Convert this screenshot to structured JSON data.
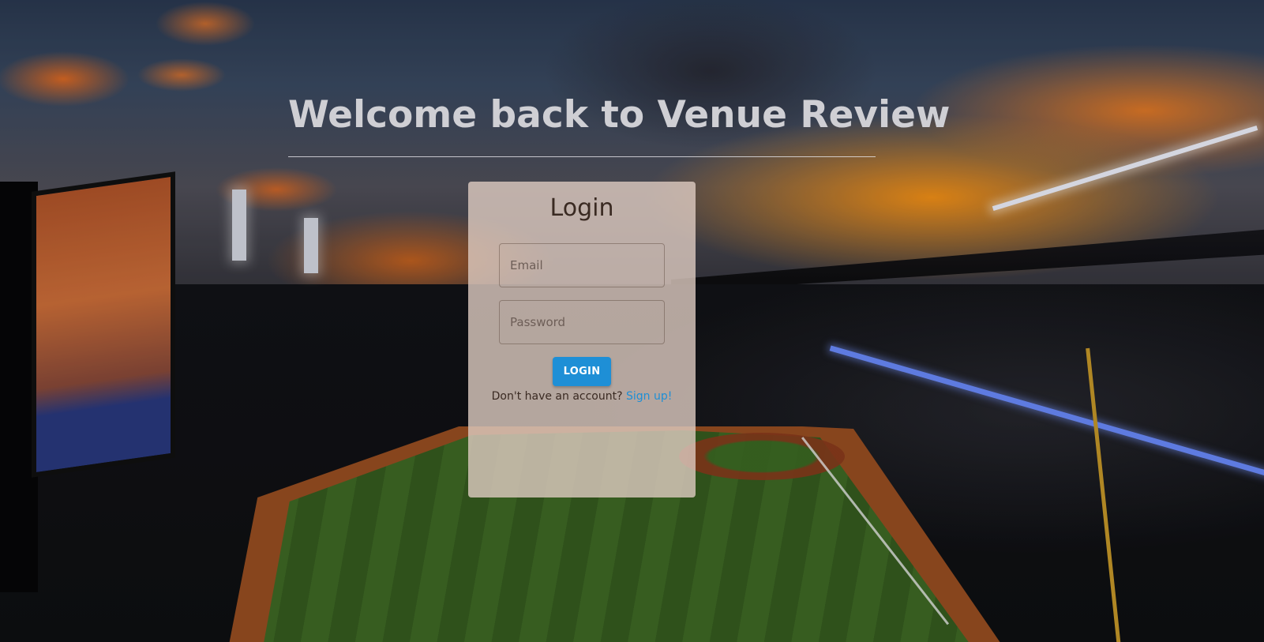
{
  "header": {
    "title": "Welcome back to Venue Review"
  },
  "login": {
    "heading": "Login",
    "email_placeholder": "Email",
    "password_placeholder": "Password",
    "submit_label": "LOGIN",
    "signup_prompt": "Don't have an account?",
    "signup_link": "Sign up!"
  },
  "colors": {
    "accent": "#1e8fd6",
    "card_background": "#decbc2",
    "title_text": "#cfcfd4"
  },
  "background": {
    "icon": "stadium-sunset-photo"
  }
}
